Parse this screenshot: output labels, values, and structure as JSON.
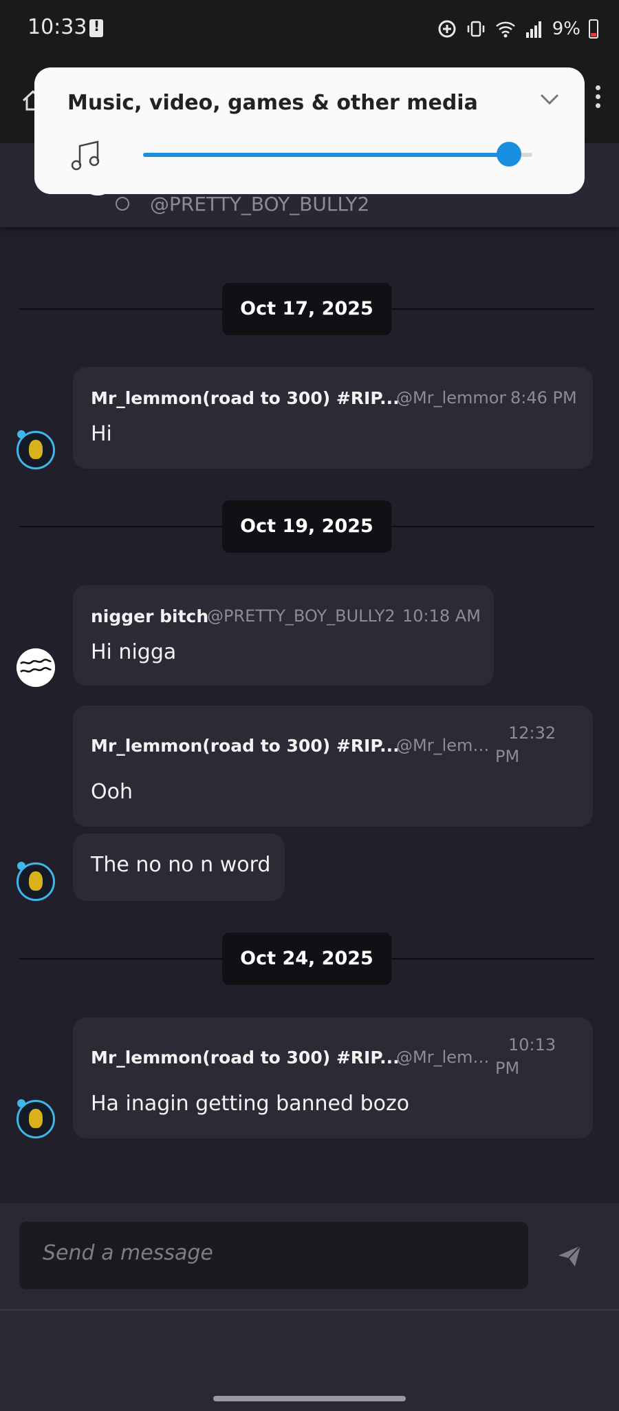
{
  "status_bar": {
    "time": "10:33",
    "battery_percent": "9%"
  },
  "volume_panel": {
    "title": "Music, video, games & other media",
    "level": 0.94
  },
  "conversation": {
    "handle": "@PRETTY_BOY_BULLY2"
  },
  "date_separators": [
    "Oct 17, 2025",
    "Oct 19, 2025",
    "Oct 24, 2025"
  ],
  "messages": [
    {
      "name": "Mr_lemmon(road to 300) #RIP...",
      "handle": "@Mr_lemmon",
      "time": "8:46 PM",
      "text": "Hi"
    },
    {
      "name": "nigger bitch",
      "handle": "@PRETTY_BOY_BULLY2",
      "time": "10:18 AM",
      "text": "Hi nigga"
    },
    {
      "name": "Mr_lemmon(road to 300) #RIP...",
      "handle": "@Mr_lemm...",
      "time_line1": "12:32",
      "time_line2": "PM",
      "text": "Ooh"
    },
    {
      "text": "The no no n word"
    },
    {
      "name": "Mr_lemmon(road to 300) #RIP...",
      "handle": "@Mr_lemm...",
      "time_line1": "10:13",
      "time_line2": "PM",
      "text": "Ha inagin getting banned bozo"
    }
  ],
  "composer": {
    "placeholder": "Send a message"
  }
}
